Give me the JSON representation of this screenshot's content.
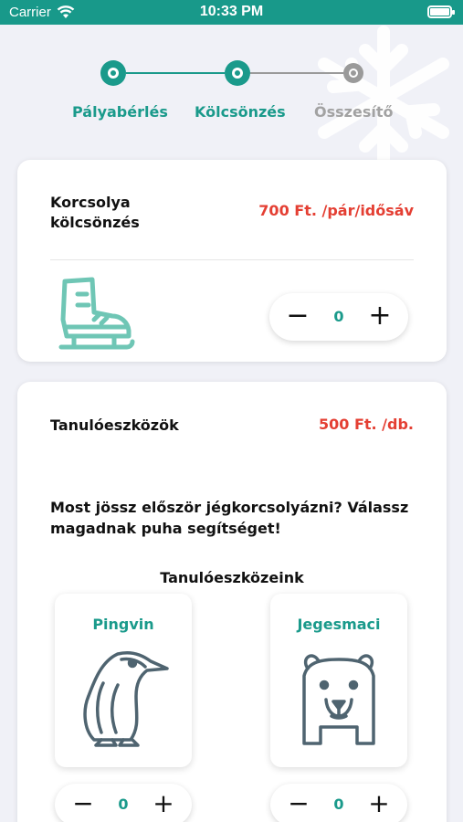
{
  "status_bar": {
    "carrier": "Carrier",
    "time": "10:33 PM"
  },
  "stepper": {
    "steps": [
      {
        "label": "Pályabérlés",
        "state": "done"
      },
      {
        "label": "Kölcsönzés",
        "state": "active"
      },
      {
        "label": "Összesítő",
        "state": "pending"
      }
    ]
  },
  "skate_rental": {
    "title": "Korcsolya kölcsönzés",
    "price": "700 Ft. /pár/idősáv",
    "icon": "ice-skate-icon",
    "quantity": "0"
  },
  "learning_tools": {
    "title": "Tanulóeszközök",
    "price": "500 Ft. /db.",
    "question": "Most jössz először jégkorcsolyázni? Válassz magadnak puha segítséget!",
    "subtitle": "Tanulóeszközeink",
    "items": [
      {
        "name": "Pingvin",
        "icon": "penguin-icon",
        "quantity": "0"
      },
      {
        "name": "Jegesmaci",
        "icon": "polar-bear-icon",
        "quantity": "0"
      }
    ]
  },
  "colors": {
    "accent": "#1a9a8b",
    "price": "#e43f33",
    "inactive": "#9a9a9a",
    "icon_skate": "#6fc6b5",
    "icon_tool": "#4f6470"
  }
}
